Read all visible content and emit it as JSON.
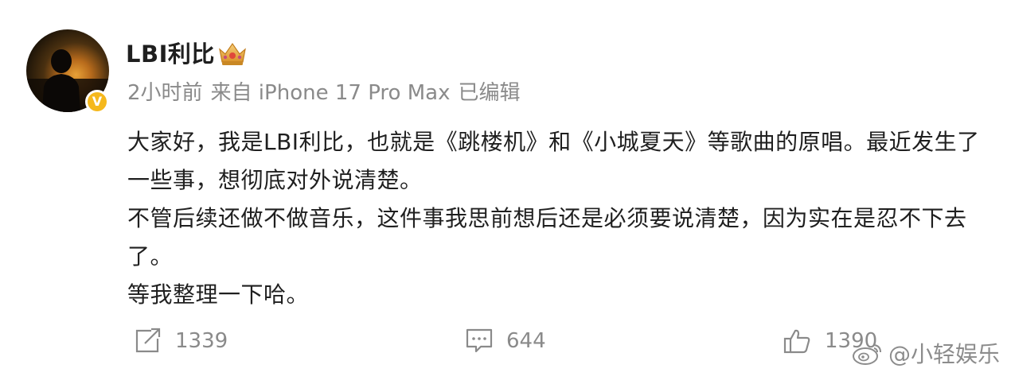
{
  "author": {
    "name": "LBI利比",
    "verified_badge": "V",
    "badge_icon": "crown-icon",
    "avatar_icon": "avatar-silhouette-sunset"
  },
  "meta": {
    "time": "2小时前",
    "source": "来自 iPhone 17 Pro Max",
    "edited": "已编辑"
  },
  "content": {
    "lines": [
      "大家好，我是LBI利比，也就是《跳楼机》和《小城夏天》等歌曲的原唱。最近发生了一些事，想彻底对外说清楚。",
      "不管后续还做不做音乐，这件事我思前想后还是必须要说清楚，因为实在是忍不下去了。",
      "等我整理一下哈。"
    ]
  },
  "actions": {
    "repost_count": "1339",
    "comment_count": "644",
    "like_count": "1390",
    "repost_icon": "repost-icon",
    "comment_icon": "comment-icon",
    "like_icon": "thumbs-up-icon"
  },
  "watermark": {
    "text": "@小轻娱乐",
    "icon": "weibo-logo-icon"
  },
  "colors": {
    "verified": "#f5b81c",
    "meta_text": "#8a8a8a",
    "body_text": "#1f1f1f"
  }
}
